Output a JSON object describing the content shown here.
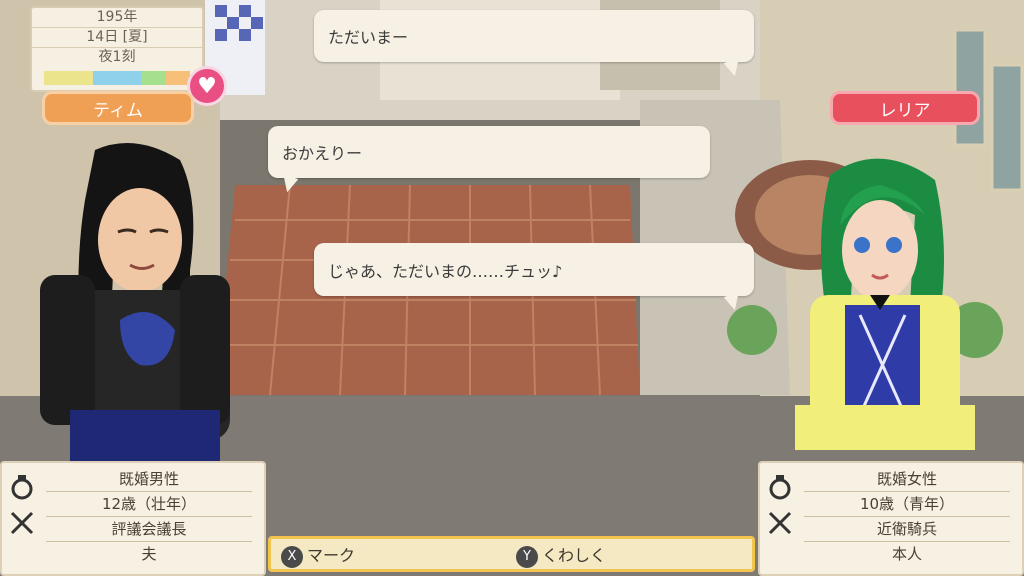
{
  "calendar": {
    "year": "195年",
    "day": "14日 [夏]",
    "time": "夜1刻",
    "season_colors": [
      "#ece48d",
      "#ece48d",
      "#8fd0ea",
      "#8fd0ea",
      "#a5e08f",
      "#f7c07a"
    ]
  },
  "heart_icon": "heart-icon",
  "left_character": {
    "name": "ティム",
    "info": {
      "status": "既婚男性",
      "age": "12歳（壮年）",
      "job": "評議会議長",
      "relation": "夫"
    }
  },
  "right_character": {
    "name": "レリア",
    "info": {
      "status": "既婚女性",
      "age": "10歳（青年）",
      "job": "近衛騎兵",
      "relation": "本人"
    }
  },
  "dialogue": [
    {
      "text": "ただいまー"
    },
    {
      "text": "おかえりー"
    },
    {
      "text": "じゃあ、ただいまの……チュッ♪"
    }
  ],
  "actions": {
    "mark": {
      "key": "X",
      "label": "マーク"
    },
    "details": {
      "key": "Y",
      "label": "くわしく"
    }
  },
  "colors": {
    "left_nameplate": "#f0a055",
    "right_nameplate": "#e9505d",
    "heart": "#ea4f84",
    "action_border": "#f2c54f"
  }
}
